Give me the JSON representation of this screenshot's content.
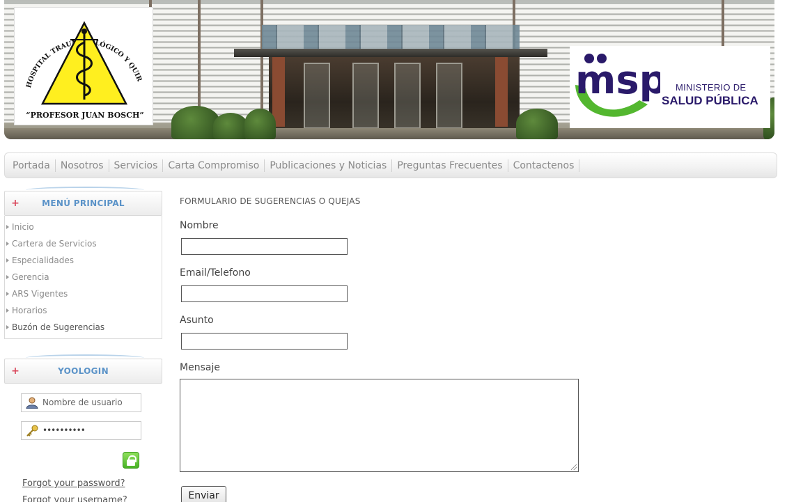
{
  "banner": {
    "hospital_logo": {
      "arc_text": "HOSPITAL TRAUMATOLÓGICO Y QUIRÚRGICO",
      "name": "“PROFESOR JUAN BOSCH”",
      "colors": {
        "triangle": "#ffef1f",
        "outline": "#111111"
      }
    },
    "ministry_logo": {
      "letters": "msp",
      "line1": "MINISTERIO DE",
      "line2": "SALUD PÚBLICA",
      "colors": {
        "letters": "#2a1a6a",
        "swoosh": "#53b72f"
      }
    }
  },
  "topnav": {
    "items": [
      "Portada",
      "Nosotros",
      "Servicios",
      "Carta Compromiso",
      "Publicaciones y Noticias",
      "Preguntas Frecuentes",
      "Contactenos"
    ]
  },
  "sidebar": {
    "main_menu": {
      "title": "MENÚ PRINCIPAL",
      "items": [
        "Inicio",
        "Cartera de Servicios",
        "Especialidades",
        "Gerencia",
        "ARS Vigentes",
        "Horarios",
        "Buzón de Sugerencias"
      ]
    },
    "login": {
      "title": "YOOLOGIN",
      "username_placeholder": "Nombre de usuario",
      "password_value": "••••••••••",
      "forgot_password": "Forgot your password?",
      "forgot_username": "Forgot your username?"
    }
  },
  "form": {
    "title": "FORMULARIO DE SUGERENCIAS O QUEJAS",
    "name_label": "Nombre",
    "contact_label": "Email/Telefono",
    "subject_label": "Asunto",
    "message_label": "Mensaje",
    "submit_label": "Enviar"
  },
  "colors": {
    "accent_blue": "#5b93c8",
    "plus_red": "#d9465a",
    "nav_text": "#8a8a8a"
  }
}
